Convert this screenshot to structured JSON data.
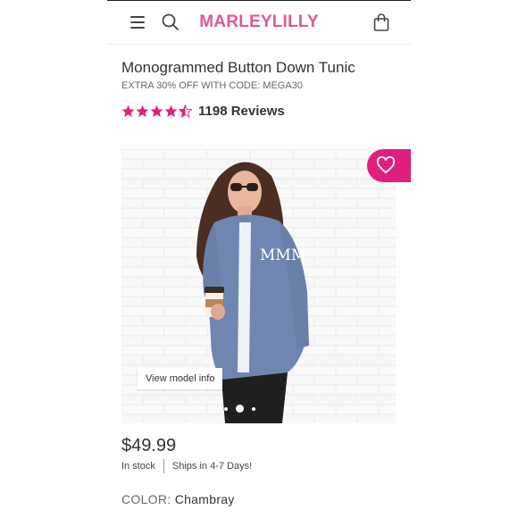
{
  "header": {
    "brand": "MARLEYLILLY"
  },
  "product": {
    "title": "Monogrammed Button Down Tunic",
    "promo": "EXTRA 30% OFF WITH CODE: MEGA30",
    "rating": 4.5,
    "reviews": "1198 Reviews",
    "price": "$49.99",
    "stock": "In stock",
    "ships": "Ships in 4-7 Days!",
    "color_label": "COLOR:",
    "color_value": "Chambray"
  },
  "gallery": {
    "model_info": "View model info",
    "slide_count": 3,
    "active_slide": 1,
    "monogram": "MMM"
  },
  "colors": {
    "brand": "#e0569b",
    "star": "#e01f7c",
    "favorite": "#e01f7c"
  },
  "icons": [
    "hamburger-icon",
    "search-icon",
    "bag-icon",
    "star-icon",
    "heart-icon"
  ]
}
